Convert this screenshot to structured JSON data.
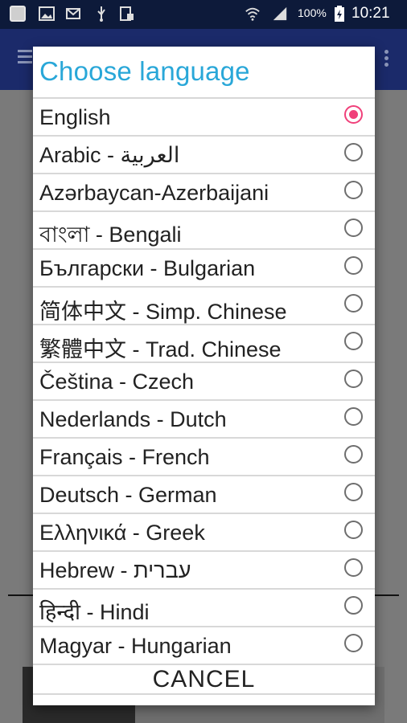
{
  "status_bar": {
    "battery": "100%",
    "time": "10:21",
    "icons": [
      "app-icon",
      "image-icon",
      "mail-icon",
      "usb-icon",
      "clipboard-icon",
      "wifi-icon",
      "signal-icon",
      "battery-icon"
    ]
  },
  "dialog": {
    "title": "Choose language",
    "languages": [
      {
        "label": "English",
        "selected": true
      },
      {
        "label": "Arabic - العربية",
        "selected": false
      },
      {
        "label": "Azərbaycan-Azerbaijani",
        "selected": false
      },
      {
        "label": "বাংলা - Bengali",
        "selected": false
      },
      {
        "label": "Български - Bulgarian",
        "selected": false
      },
      {
        "label": "简体中文 - Simp. Chinese",
        "selected": false
      },
      {
        "label": "繁體中文 - Trad. Chinese",
        "selected": false
      },
      {
        "label": "Čeština - Czech",
        "selected": false
      },
      {
        "label": "Nederlands - Dutch",
        "selected": false
      },
      {
        "label": "Français - French",
        "selected": false
      },
      {
        "label": "Deutsch - German",
        "selected": false
      },
      {
        "label": "Ελληνικά - Greek",
        "selected": false
      },
      {
        "label": "Hebrew - עברית",
        "selected": false
      },
      {
        "label": "हिन्दी - Hindi",
        "selected": false
      },
      {
        "label": "Magyar - Hungarian",
        "selected": false
      }
    ],
    "cancel_label": "CANCEL"
  },
  "colors": {
    "title": "#29a7d8",
    "radio_selected": "#f0407a",
    "appbar": "#1b2a6a"
  }
}
